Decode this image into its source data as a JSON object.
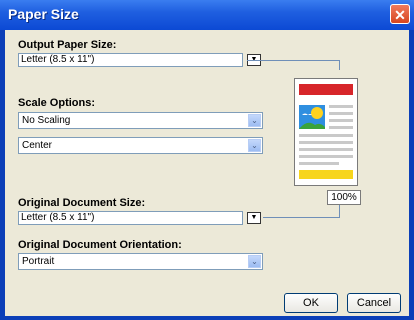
{
  "window": {
    "title": "Paper Size",
    "close_glyph": "✕"
  },
  "output": {
    "label": "Output Paper Size:",
    "value": "Letter (8.5 x 11\")",
    "dropdown_glyph": "▼"
  },
  "scale": {
    "label": "Scale Options:",
    "scaling_value": "No Scaling",
    "position_value": "Center",
    "arrow_glyph": "⌄"
  },
  "preview": {
    "zoom": "100%"
  },
  "original": {
    "size_label": "Original Document Size:",
    "size_value": "Letter (8.5 x 11\")",
    "size_dropdown_glyph": "▼",
    "orientation_label": "Original Document Orientation:",
    "orientation_value": "Portrait"
  },
  "buttons": {
    "ok": "OK",
    "cancel": "Cancel"
  },
  "colors": {
    "title_bar": "#1f5fe0",
    "dialog_bg": "#ece9d8",
    "preview_header": "#d7262a",
    "preview_footer": "#f7d51c",
    "preview_image_sky": "#2f8fe0",
    "preview_image_sun": "#ffd21f",
    "preview_image_hill": "#3aa33a"
  }
}
